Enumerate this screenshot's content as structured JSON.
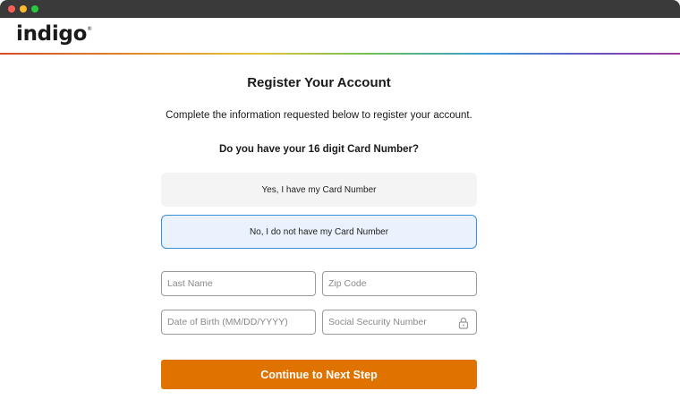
{
  "brand": {
    "logo_text": "indigo",
    "logo_mark": "®"
  },
  "page": {
    "title": "Register Your Account",
    "subtitle": "Complete the information requested below to register your account.",
    "question": "Do you have your 16 digit Card Number?"
  },
  "choices": {
    "yes": "Yes, I have my Card Number",
    "no": "No, I do not have my Card Number",
    "selected": "no"
  },
  "form": {
    "last_name": {
      "placeholder": "Last Name",
      "value": ""
    },
    "zip_code": {
      "placeholder": "Zip Code",
      "value": ""
    },
    "dob": {
      "placeholder": "Date of Birth (MM/DD/YYYY)",
      "value": ""
    },
    "ssn": {
      "placeholder": "Social Security Number",
      "value": "",
      "icon": "lock-icon"
    }
  },
  "actions": {
    "continue_label": "Continue to Next Step"
  },
  "colors": {
    "accent": "#e07300",
    "selected_border": "#3b8fd9",
    "selected_bg": "#eaf3fd"
  }
}
